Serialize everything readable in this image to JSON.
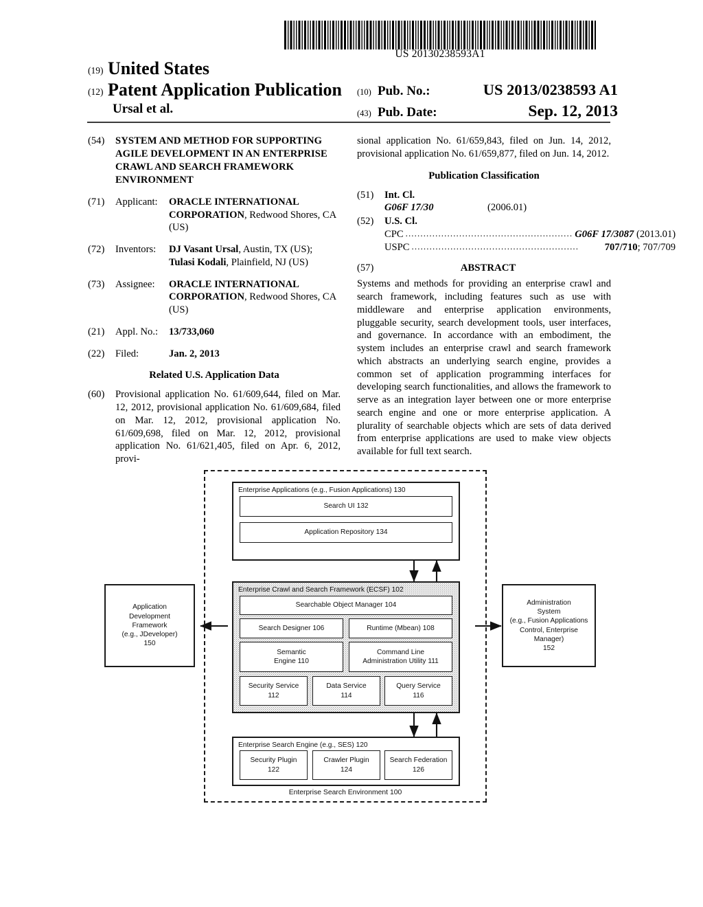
{
  "header": {
    "barcode_number": "US 20130238593A1",
    "kind_19_num": "(19)",
    "country": "United States",
    "kind_12_num": "(12)",
    "doc_type": "Patent Application Publication",
    "inventor_short": "Ursal et al.",
    "pub_no_num": "(10)",
    "pub_no_label": "Pub. No.:",
    "pub_no_value": "US 2013/0238593 A1",
    "pub_date_num": "(43)",
    "pub_date_label": "Pub. Date:",
    "pub_date_value": "Sep. 12, 2013"
  },
  "left_column": {
    "title_num": "(54)",
    "title": "SYSTEM AND METHOD FOR SUPPORTING AGILE DEVELOPMENT IN AN ENTERPRISE CRAWL AND SEARCH FRAMEWORK ENVIRONMENT",
    "applicant_num": "(71)",
    "applicant_label": "Applicant:",
    "applicant_name": "ORACLE INTERNATIONAL CORPORATION",
    "applicant_rest": ", Redwood Shores, CA (US)",
    "inventors_num": "(72)",
    "inventors_label": "Inventors:",
    "inventor1_name": "DJ Vasant Ursal",
    "inventor1_rest": ", Austin, TX (US);",
    "inventor2_name": "Tulasi Kodali",
    "inventor2_rest": ", Plainfield, NJ (US)",
    "assignee_num": "(73)",
    "assignee_label": "Assignee:",
    "assignee_name": "ORACLE INTERNATIONAL CORPORATION",
    "assignee_rest": ", Redwood Shores, CA (US)",
    "appl_no_num": "(21)",
    "appl_no_label": "Appl. No.:",
    "appl_no_value": "13/733,060",
    "filed_num": "(22)",
    "filed_label": "Filed:",
    "filed_value": "Jan. 2, 2013",
    "related_head": "Related U.S. Application Data",
    "related_num": "(60)",
    "related_text": "Provisional application No. 61/609,644, filed on Mar. 12, 2012, provisional application No. 61/609,684, filed on Mar. 12, 2012, provisional application No. 61/609,698, filed on Mar. 12, 2012, provisional application No. 61/621,405, filed on Apr. 6, 2012, provi-"
  },
  "right_column": {
    "continuation_text": "sional application No. 61/659,843, filed on Jun. 14, 2012, provisional application No. 61/659,877, filed on Jun. 14, 2012.",
    "classification_head": "Publication Classification",
    "int_cl_num": "(51)",
    "int_cl_label": "Int. Cl.",
    "int_cl_code": "G06F 17/30",
    "int_cl_version": "(2006.01)",
    "us_cl_num": "(52)",
    "us_cl_label": "U.S. Cl.",
    "cpc_label": "CPC",
    "cpc_code": "G06F 17/3087",
    "cpc_version": "(2013.01)",
    "uspc_label": "USPC",
    "uspc_primary": "707/710",
    "uspc_secondary": "; 707/709",
    "abstract_num": "(57)",
    "abstract_head": "ABSTRACT",
    "abstract_text": "Systems and methods for providing an enterprise crawl and search framework, including features such as use with middleware and enterprise application environments, pluggable security, search development tools, user interfaces, and governance. In accordance with an embodiment, the system includes an enterprise crawl and search framework which abstracts an underlying search engine, provides a common set of application programming interfaces for developing search functionalities, and allows the framework to serve as an integration layer between one or more enterprise search engine and one or more enterprise application. A plurality of searchable objects which are sets of data derived from enterprise applications are used to make view objects available for full text search."
  },
  "figure": {
    "environment_caption": "Enterprise Search Environment 100",
    "enterprise_apps_label": "Enterprise Applications (e.g., Fusion Applications) 130",
    "search_ui_label": "Search UI 132",
    "app_repository_label": "Application Repository 134",
    "ecsf_label": "Enterprise Crawl and Search Framework (ECSF) 102",
    "searchable_object_manager_label": "Searchable Object Manager 104",
    "search_designer_label": "Search Designer 106",
    "runtime_label": "Runtime (Mbean) 108",
    "semantic_engine_line1": "Semantic",
    "semantic_engine_line2": "Engine 110",
    "cmdline_line1": "Command Line",
    "cmdline_line2": "Administration Utility 111",
    "security_service_line1": "Security Service",
    "security_service_line2": "112",
    "data_service_line1": "Data Service",
    "data_service_line2": "114",
    "query_service_line1": "Query Service",
    "query_service_line2": "116",
    "search_engine_label": "Enterprise Search Engine (e.g., SES)  120",
    "security_plugin_line1": "Security Plugin",
    "security_plugin_line2": "122",
    "crawler_plugin_line1": "Crawler Plugin",
    "crawler_plugin_line2": "124",
    "search_federation_line1": "Search Federation",
    "search_federation_line2": "126",
    "adf_line1": "Application",
    "adf_line2": "Development",
    "adf_line3": "Framework",
    "adf_line4": "(e.g., JDeveloper)",
    "adf_line5": "150",
    "admin_line1": "Administration",
    "admin_line2": "System",
    "admin_line3": "(e.g., Fusion Applications",
    "admin_line4": "Control, Enterprise",
    "admin_line5": "Manager)",
    "admin_line6": "152"
  }
}
